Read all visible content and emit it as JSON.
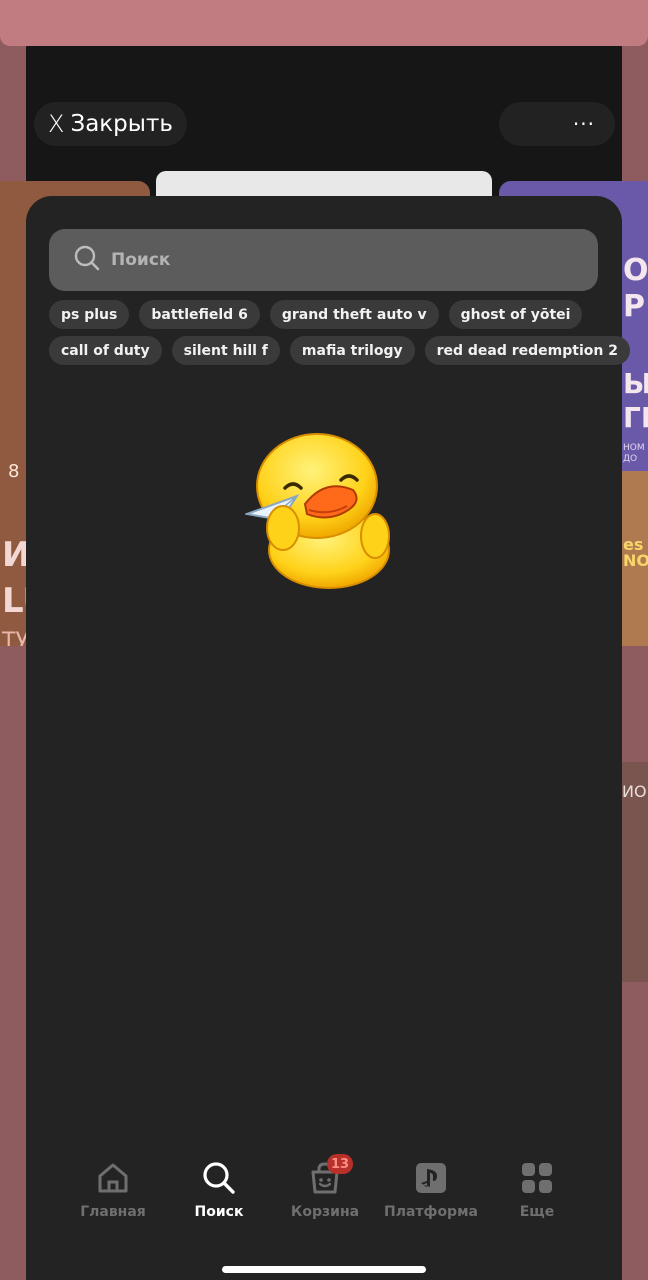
{
  "topbar": {
    "close_label": "Закрыть",
    "close_glyph": "X",
    "menu_label": "···"
  },
  "background": {
    "left_card": {
      "line1": "ИС",
      "line2": "LU",
      "line3": "ТУ",
      "num": "8"
    },
    "right_card": {
      "line1": "О",
      "line2": "Р",
      "line3": "ЫЕ",
      "line4": "ГР",
      "small1": "НОМ",
      "small2": "ДО",
      "art_text1": "es",
      "art_text2": "NO"
    },
    "right_card2": {
      "text": "ИО"
    }
  },
  "search": {
    "placeholder": "Поиск"
  },
  "chips": {
    "row1": [
      "ps plus",
      "battlefield 6",
      "grand theft auto v",
      "ghost of yōtei"
    ],
    "row2": [
      "call of duty",
      "silent hill f",
      "mafia trilogy",
      "red dead redemption 2"
    ]
  },
  "nav": {
    "items": [
      {
        "label": "Главная",
        "icon": "home-icon"
      },
      {
        "label": "Поиск",
        "icon": "search-icon"
      },
      {
        "label": "Корзина",
        "icon": "cart-icon",
        "badge": "13"
      },
      {
        "label": "Платформа",
        "icon": "playstation-icon"
      },
      {
        "label": "Еще",
        "icon": "grid-icon"
      }
    ]
  },
  "colors": {
    "overlay": "#8e5c5f",
    "sheet": "#232323",
    "chip": "#3a3a3a",
    "search_bg": "#5c5c5c",
    "badge": "#b7312a"
  }
}
